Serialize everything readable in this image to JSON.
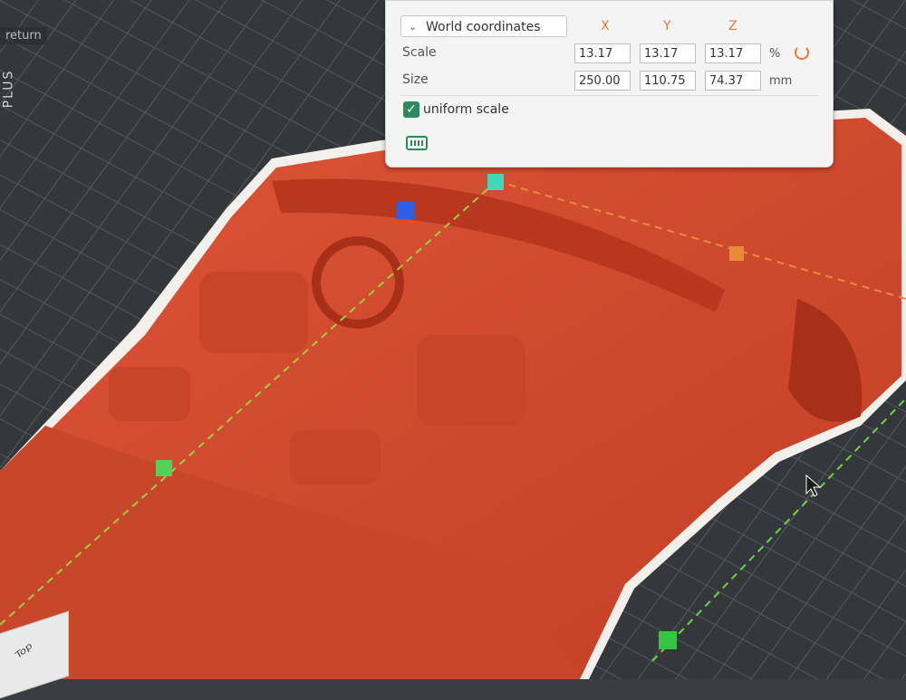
{
  "viewport": {
    "label": "return",
    "brand": "PLUS"
  },
  "panel": {
    "coord_system": "World coordinates",
    "axes": [
      "X",
      "Y",
      "Z"
    ],
    "scale": {
      "label": "Scale",
      "x": "13.17",
      "y": "13.17",
      "z": "13.17",
      "unit": "%"
    },
    "size": {
      "label": "Size",
      "x": "250.00",
      "y": "110.75",
      "z": "74.37",
      "unit": "mm"
    },
    "uniform_scale": {
      "label": "uniform scale",
      "checked": true
    }
  },
  "view_cube": {
    "label": "Top"
  },
  "colors": {
    "model": "#d2472d",
    "accent": "#e07a3a",
    "check": "#2e8a5c",
    "grid_bg": "#3a3d41"
  },
  "icons": [
    "chevron-down-icon",
    "reset-icon",
    "check-icon",
    "keyboard-icon"
  ]
}
